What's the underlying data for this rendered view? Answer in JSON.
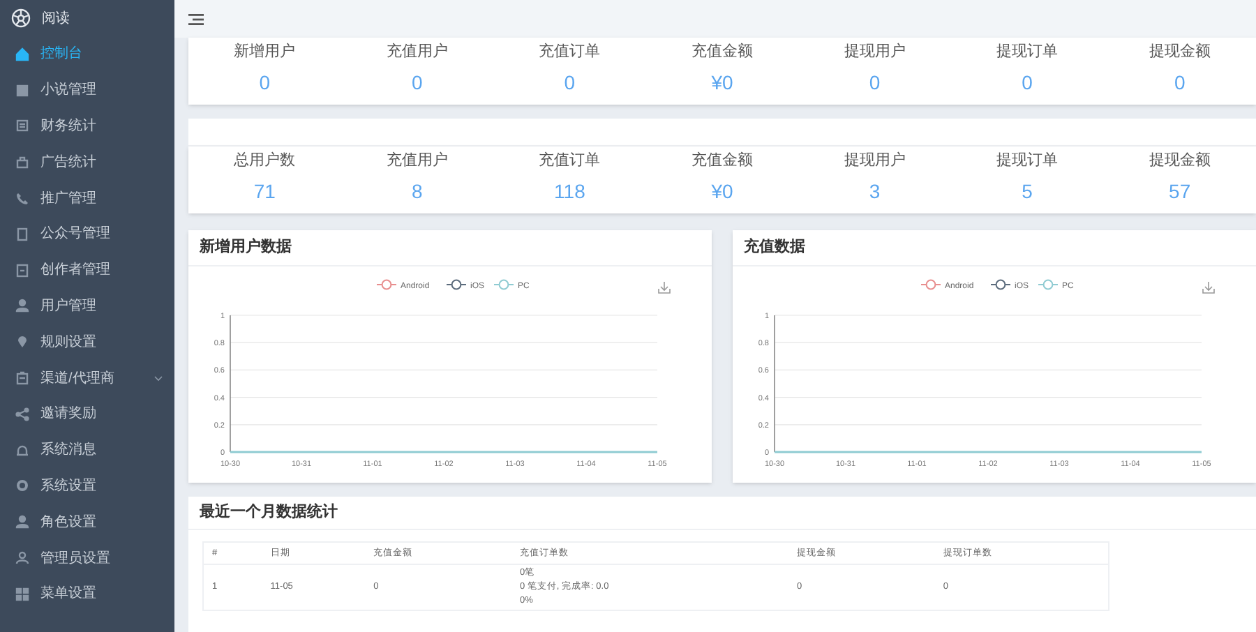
{
  "sidebar": {
    "logo_text": "阅读",
    "items": [
      {
        "label": "控制台",
        "selected": true,
        "kind": "home"
      },
      {
        "label": "小说管理",
        "selected": false,
        "kind": "book"
      },
      {
        "label": "财务统计",
        "selected": false,
        "kind": "form"
      },
      {
        "label": "广告统计",
        "selected": false,
        "kind": "bag"
      },
      {
        "label": "推广管理",
        "selected": false,
        "kind": "phone"
      },
      {
        "label": "公众号管理",
        "selected": false,
        "kind": "tablet"
      },
      {
        "label": "创作者管理",
        "selected": false,
        "kind": "doc"
      },
      {
        "label": "用户管理",
        "selected": false,
        "kind": "user"
      },
      {
        "label": "规则设置",
        "selected": false,
        "kind": "pin"
      },
      {
        "label": "渠道/代理商",
        "selected": false,
        "kind": "clipboard",
        "expandable": true
      },
      {
        "label": "邀请奖励",
        "selected": false,
        "kind": "share"
      },
      {
        "label": "系统消息",
        "selected": false,
        "kind": "bell"
      },
      {
        "label": "系统设置",
        "selected": false,
        "kind": "gear"
      },
      {
        "label": "角色设置",
        "selected": false,
        "kind": "user"
      },
      {
        "label": "管理员设置",
        "selected": false,
        "kind": "person"
      },
      {
        "label": "菜单设置",
        "selected": false,
        "kind": "grid"
      }
    ]
  },
  "today_stats": [
    {
      "label": "新增用户",
      "value": "0"
    },
    {
      "label": "充值用户",
      "value": "0"
    },
    {
      "label": "充值订单",
      "value": "0"
    },
    {
      "label": "充值金额",
      "value": "¥0"
    },
    {
      "label": "提现用户",
      "value": "0"
    },
    {
      "label": "提现订单",
      "value": "0"
    },
    {
      "label": "提现金额",
      "value": "0"
    }
  ],
  "total_stats": [
    {
      "label": "总用户数",
      "value": "71"
    },
    {
      "label": "充值用户",
      "value": "8"
    },
    {
      "label": "充值订单",
      "value": "118"
    },
    {
      "label": "充值金额",
      "value": "¥0"
    },
    {
      "label": "提现用户",
      "value": "3"
    },
    {
      "label": "提现订单",
      "value": "5"
    },
    {
      "label": "提现金额",
      "value": "57"
    }
  ],
  "charts": [
    {
      "title": "新增用户数据",
      "chart_data": {
        "type": "line",
        "categories": [
          "10-30",
          "10-31",
          "11-01",
          "11-02",
          "11-03",
          "11-04",
          "11-05"
        ],
        "ylim": [
          0,
          1
        ],
        "yticks": [
          0,
          0.2,
          0.4,
          0.6,
          0.8,
          1
        ],
        "grid": true,
        "legend": true,
        "series": [
          {
            "name": "Android",
            "color": "#e88e8e",
            "values": [
              null,
              null,
              null,
              null,
              null,
              null,
              null
            ]
          },
          {
            "name": "iOS",
            "color": "#5b6b7c",
            "values": [
              null,
              null,
              null,
              null,
              null,
              null,
              null
            ]
          },
          {
            "name": "PC",
            "color": "#8fcbd2",
            "values": [
              0,
              0,
              0,
              0,
              0,
              0,
              0
            ]
          }
        ]
      }
    },
    {
      "title": "充值数据",
      "chart_data": {
        "type": "line",
        "categories": [
          "10-30",
          "10-31",
          "11-01",
          "11-02",
          "11-03",
          "11-04",
          "11-05"
        ],
        "ylim": [
          0,
          1
        ],
        "yticks": [
          0,
          0.2,
          0.4,
          0.6,
          0.8,
          1
        ],
        "grid": true,
        "legend": true,
        "series": [
          {
            "name": "Android",
            "color": "#e88e8e",
            "values": [
              null,
              null,
              null,
              null,
              null,
              null,
              null
            ]
          },
          {
            "name": "iOS",
            "color": "#5b6b7c",
            "values": [
              null,
              null,
              null,
              null,
              null,
              null,
              null
            ]
          },
          {
            "name": "PC",
            "color": "#8fcbd2",
            "values": [
              0,
              0,
              0,
              0,
              0,
              0,
              0
            ]
          }
        ]
      }
    }
  ],
  "monthly": {
    "title": "最近一个月数据统计",
    "columns": [
      "#",
      "日期",
      "充值金额",
      "充值订单数",
      "提现金额",
      "提现订单数"
    ],
    "rows": [
      {
        "cells": [
          "1",
          "11-05",
          "0",
          [
            "0笔",
            "0 笔支付, 完成率: 0.0",
            "0%"
          ],
          "0",
          "0"
        ]
      }
    ]
  }
}
